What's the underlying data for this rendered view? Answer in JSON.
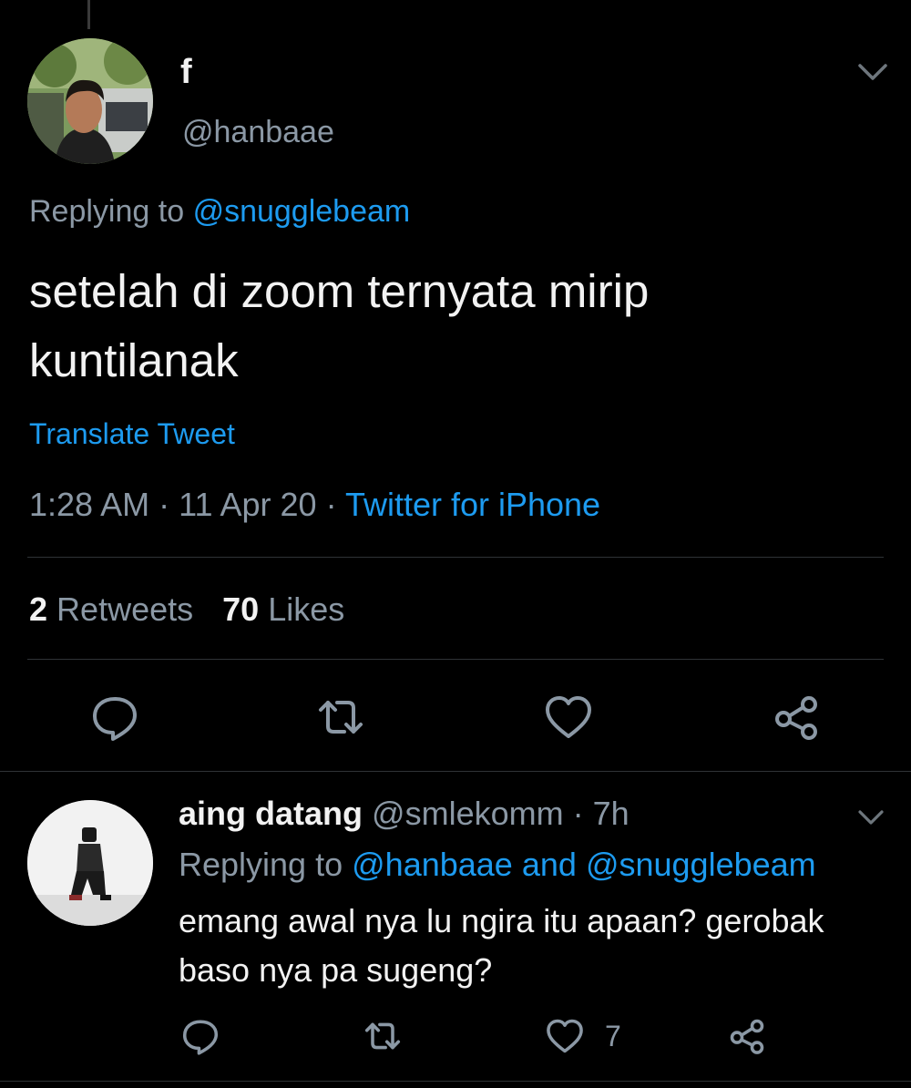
{
  "tweet": {
    "author": {
      "name": "f",
      "handle": "@hanbaae"
    },
    "replying_label": "Replying to",
    "replying_to": "@snugglebeam",
    "text": "setelah di zoom ternyata mirip kuntilanak",
    "translate_label": "Translate Tweet",
    "time": "1:28 AM",
    "date": "11 Apr 20",
    "separator": "·",
    "source": "Twitter for iPhone",
    "retweets_count": "2",
    "retweets_label": "Retweets",
    "likes_count": "70",
    "likes_label": "Likes",
    "actions": [
      "reply-icon",
      "retweet-icon",
      "like-icon",
      "share-icon"
    ]
  },
  "reply": {
    "name": "aing datang",
    "handle": "@smlekomm",
    "separator": "·",
    "time": "7h",
    "replying_label": "Replying to",
    "replying_to_1": "@hanbaae",
    "and_label": "and",
    "replying_to_2": "@snugglebeam",
    "text": "emang awal nya lu ngira itu apaan? gerobak baso nya pa sugeng?",
    "like_count": "7",
    "actions": [
      "reply-icon",
      "retweet-icon",
      "like-icon",
      "share-icon"
    ]
  },
  "colors": {
    "background": "#000000",
    "link": "#1d9bf0",
    "secondary_text": "#8b98a5",
    "primary_text": "#f2f2f2",
    "divider": "#2f3336"
  }
}
